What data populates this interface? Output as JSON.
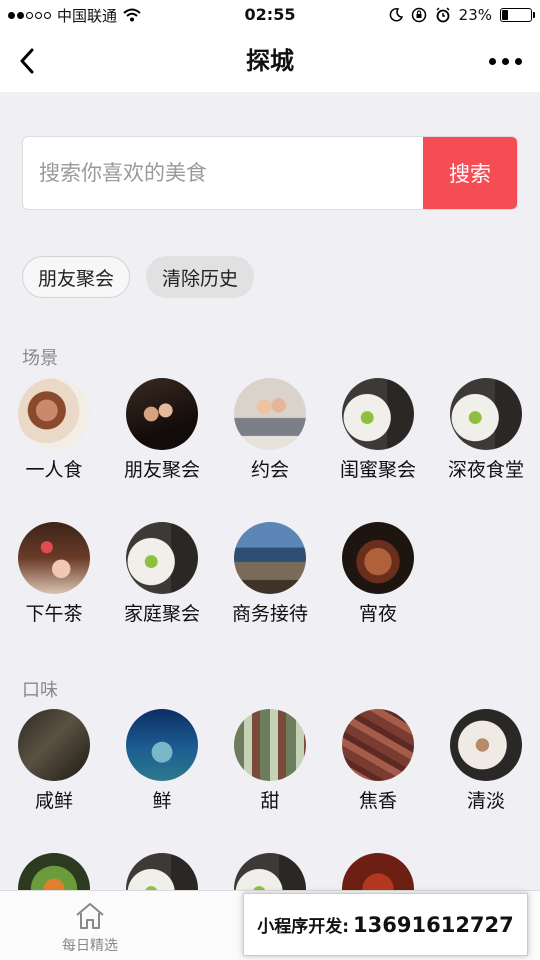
{
  "status_bar": {
    "carrier": "中国联通",
    "time": "02:55",
    "battery": "23%",
    "battery_level": 0.23
  },
  "nav": {
    "title": "探城"
  },
  "search": {
    "placeholder": "搜索你喜欢的美食",
    "button": "搜索"
  },
  "history": {
    "chips": [
      "朋友聚会"
    ],
    "clear": "清除历史"
  },
  "scene": {
    "title": "场景",
    "items": [
      {
        "label": "一人食",
        "image": "food-plate-photo"
      },
      {
        "label": "朋友聚会",
        "image": "party-photo"
      },
      {
        "label": "约会",
        "image": "couple-photo"
      },
      {
        "label": "闺蜜聚会",
        "image": "plate-fork-photo"
      },
      {
        "label": "深夜食堂",
        "image": "plate-fork-photo"
      },
      {
        "label": "下午茶",
        "image": "dessert-photo"
      },
      {
        "label": "家庭聚会",
        "image": "plate-fork-photo"
      },
      {
        "label": "商务接待",
        "image": "restaurant-view-photo"
      },
      {
        "label": "宵夜",
        "image": "pastry-photo"
      }
    ]
  },
  "taste": {
    "title": "口味",
    "items": [
      {
        "label": "咸鲜",
        "image": "dark-interior-photo"
      },
      {
        "label": "鲜",
        "image": "aquarium-photo"
      },
      {
        "label": "甜",
        "image": "dessert-display-photo"
      },
      {
        "label": "焦香",
        "image": "grilled-meat-photo"
      },
      {
        "label": "清淡",
        "image": "soup-photo"
      }
    ]
  },
  "tab_bar": {
    "home_label": "每日精选"
  },
  "promo": {
    "label": "小程序开发:",
    "phone": "13691612727"
  }
}
